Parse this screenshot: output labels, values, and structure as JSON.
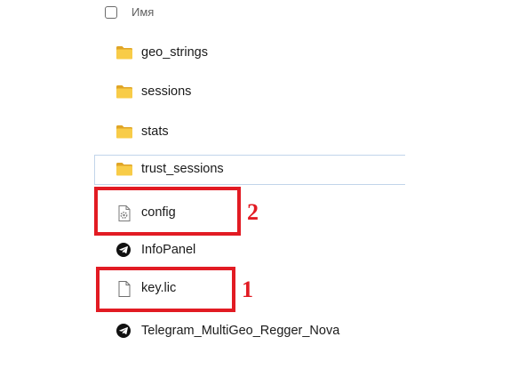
{
  "header": {
    "column_name": "Имя"
  },
  "files": [
    {
      "name": "geo_strings",
      "type": "folder",
      "icon": "folder-icon"
    },
    {
      "name": "sessions",
      "type": "folder",
      "icon": "folder-icon"
    },
    {
      "name": "stats",
      "type": "folder",
      "icon": "folder-icon"
    },
    {
      "name": "trust_sessions",
      "type": "folder",
      "icon": "folder-icon"
    },
    {
      "name": "config",
      "type": "settings-file",
      "icon": "config-file-icon"
    },
    {
      "name": "InfoPanel",
      "type": "telegram-app",
      "icon": "telegram-icon"
    },
    {
      "name": "key.lic",
      "type": "file",
      "icon": "document-icon"
    },
    {
      "name": "Telegram_MultiGeo_Regger_Nova",
      "type": "telegram-app",
      "icon": "telegram-icon"
    }
  ],
  "annotations": [
    {
      "label": "2",
      "target": "config"
    },
    {
      "label": "1",
      "target": "key.lic"
    }
  ],
  "colors": {
    "highlight": "#e21b23",
    "folder": "#f4c430",
    "focus_border": "#c2d5ea"
  }
}
